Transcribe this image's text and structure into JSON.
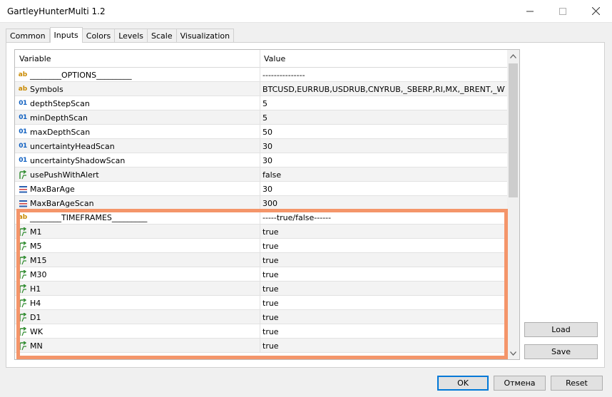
{
  "window": {
    "title": "GartleyHunterMulti 1.2"
  },
  "tabs": [
    {
      "label": "Common"
    },
    {
      "label": "Inputs"
    },
    {
      "label": "Colors"
    },
    {
      "label": "Levels"
    },
    {
      "label": "Scale"
    },
    {
      "label": "Visualization"
    }
  ],
  "active_tab": "Inputs",
  "grid": {
    "headers": {
      "variable": "Variable",
      "value": "Value"
    },
    "rows": [
      {
        "type": "ab",
        "name": "________OPTIONS_________",
        "value": "---------------"
      },
      {
        "type": "ab",
        "name": "Symbols",
        "value": "BTCUSD,EURRUB,USDRUB,CNYRUB,_SBERP,RI,MX,_BRENT,_WTI,..."
      },
      {
        "type": "01",
        "name": "depthStepScan",
        "value": "5"
      },
      {
        "type": "01",
        "name": "minDepthScan",
        "value": "5"
      },
      {
        "type": "01",
        "name": "maxDepthScan",
        "value": "50"
      },
      {
        "type": "01",
        "name": "uncertaintyHeadScan",
        "value": "30"
      },
      {
        "type": "01",
        "name": "uncertaintyShadowScan",
        "value": "30"
      },
      {
        "type": "bool",
        "name": "usePushWithAlert",
        "value": "false"
      },
      {
        "type": "enum",
        "name": "MaxBarAge",
        "value": "30"
      },
      {
        "type": "enum",
        "name": "MaxBarAgeScan",
        "value": "300"
      },
      {
        "type": "ab",
        "name": "________TIMEFRAMES_________",
        "value": "-----true/false------"
      },
      {
        "type": "bool",
        "name": "M1",
        "value": "true"
      },
      {
        "type": "bool",
        "name": "M5",
        "value": "true"
      },
      {
        "type": "bool",
        "name": "M15",
        "value": "true"
      },
      {
        "type": "bool",
        "name": "M30",
        "value": "true"
      },
      {
        "type": "bool",
        "name": "H1",
        "value": "true"
      },
      {
        "type": "bool",
        "name": "H4",
        "value": "true"
      },
      {
        "type": "bool",
        "name": "D1",
        "value": "true"
      },
      {
        "type": "bool",
        "name": "WK",
        "value": "true"
      },
      {
        "type": "bool",
        "name": "MN",
        "value": "true"
      }
    ]
  },
  "icons": {
    "ab": "string-type-icon",
    "01": "integer-type-icon",
    "bool": "boolean-arrow-icon",
    "enum": "enum-list-icon"
  },
  "buttons": {
    "load": "Load",
    "save": "Save",
    "ok": "OK",
    "cancel": "Отмена",
    "reset": "Reset"
  },
  "colors": {
    "highlight": "#f4956a",
    "bool_icon": "#2e8b2e",
    "string_icon": "#c98a00",
    "int_icon": "#1060c0",
    "enum_icon": "#2a5fb0"
  }
}
